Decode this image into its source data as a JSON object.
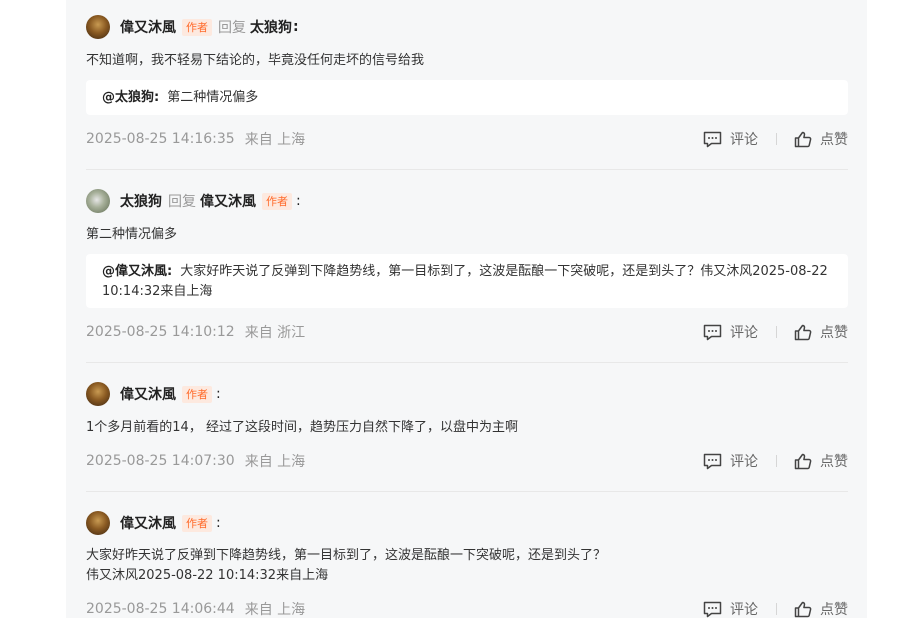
{
  "author_tag": "作者",
  "reply_word": "回复",
  "colon": ":",
  "actions": {
    "comment_label": "评论",
    "like_label": "点赞"
  },
  "comments": [
    {
      "user": "偉又沐風",
      "is_author": true,
      "reply_to": "太狼狗",
      "text": "不知道啊，我不轻易下结论的，毕竟没任何走坏的信号给我",
      "quote_user": "@太狼狗:",
      "quote_text": "第二种情况偏多",
      "time": "2025-08-25 14:16:35",
      "location": "来自 上海"
    },
    {
      "user": "太狼狗",
      "is_author": false,
      "reply_to": "偉又沐風",
      "text": "第二种情况偏多",
      "quote_user": "@偉又沐風:",
      "quote_text": "大家好昨天说了反弹到下降趋势线，第一目标到了，这波是酝酿一下突破呢，还是到头了？伟又沐风2025-08-22 10:14:32来自上海",
      "time": "2025-08-25 14:10:12",
      "location": "来自 浙江"
    },
    {
      "user": "偉又沐風",
      "is_author": true,
      "text": "1个多月前看的14， 经过了这段时间，趋势压力自然下降了，以盘中为主啊",
      "time": "2025-08-25 14:07:30",
      "location": "来自 上海"
    },
    {
      "user": "偉又沐風",
      "is_author": true,
      "text_line1": "大家好昨天说了反弹到下降趋势线，第一目标到了，这波是酝酿一下突破呢，还是到头了？",
      "text_line2": "伟又沐风2025-08-22 10:14:32来自上海",
      "time": "2025-08-25 14:06:44",
      "location": "来自 上海"
    }
  ]
}
